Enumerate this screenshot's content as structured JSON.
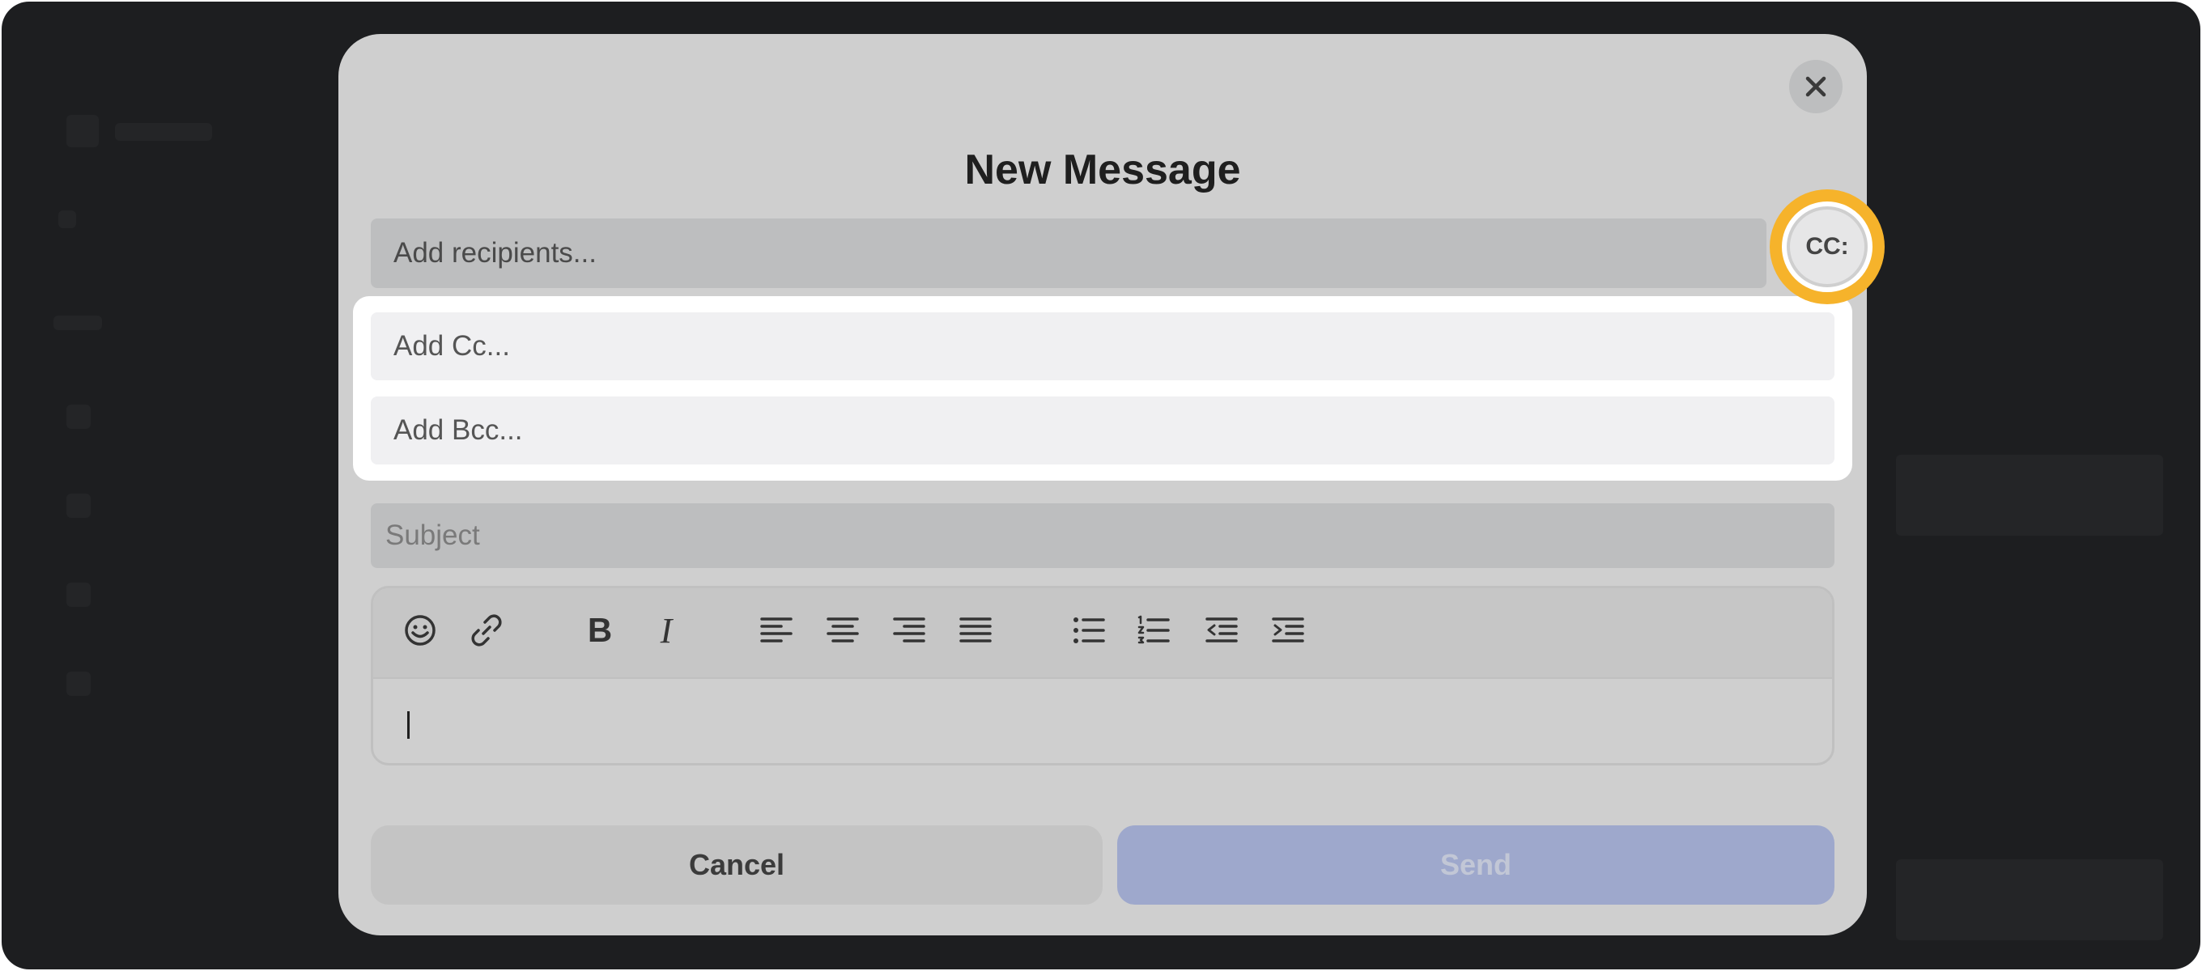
{
  "modal": {
    "title": "New Message",
    "recipients_placeholder": "Add recipients...",
    "cc_button_label": "CC:",
    "cc_placeholder": "Add Cc...",
    "bcc_placeholder": "Add Bcc...",
    "subject_placeholder": "Subject",
    "body_value": "",
    "cancel_label": "Cancel",
    "send_label": "Send"
  },
  "toolbar": {
    "icons": [
      "emoji-icon",
      "link-icon",
      "bold-icon",
      "italic-icon",
      "align-left-icon",
      "align-center-icon",
      "align-right-icon",
      "align-justify-icon",
      "bullet-list-icon",
      "numbered-list-icon",
      "outdent-icon",
      "indent-icon"
    ],
    "bold_glyph": "B",
    "italic_glyph": "I"
  },
  "colors": {
    "overlay": "#1d1e20",
    "modal": "#cfcfcf",
    "highlight": "#f6b32b",
    "send_button": "#9ea8cc"
  }
}
